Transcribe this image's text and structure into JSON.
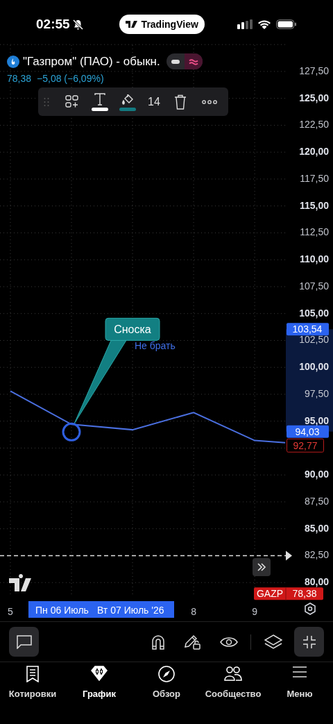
{
  "status_bar": {
    "time": "02:55",
    "app_pill": "TradingView"
  },
  "legend": {
    "symbol": "\"Газпром\" (ПАО) - обыкн.",
    "chart_toggle": [
      {
        "selected": false
      },
      {
        "selected": true
      }
    ],
    "price": "78,38",
    "change": "−5,08 (−6,09%)"
  },
  "drawing_toolbar": {
    "font_size": "14"
  },
  "chart": {
    "chart_data": {
      "type": "line",
      "x": [
        5,
        6,
        7,
        8,
        9,
        9.5
      ],
      "series": [
        {
          "color": "#4a6fe0",
          "values": [
            97.8,
            94.7,
            94.2,
            95.8,
            93.2,
            93.0
          ]
        }
      ],
      "xlim": [
        4.83,
        9.51
      ],
      "ylim": [
        78.66,
        130.27
      ],
      "grid": true,
      "xticks": [
        {
          "value": 5,
          "label": "5"
        },
        {
          "value": 8,
          "label": "8"
        },
        {
          "value": 9,
          "label": "9"
        }
      ],
      "yticks": [
        {
          "value": 127.5,
          "label": "127,50"
        },
        {
          "value": 125,
          "label": "125,00"
        },
        {
          "value": 122.5,
          "label": "122,50"
        },
        {
          "value": 120,
          "label": "120,00"
        },
        {
          "value": 117.5,
          "label": "117,50"
        },
        {
          "value": 115,
          "label": "115,00"
        },
        {
          "value": 112.5,
          "label": "112,50"
        },
        {
          "value": 110,
          "label": "110,00"
        },
        {
          "value": 107.5,
          "label": "107,50"
        },
        {
          "value": 105,
          "label": "105,00"
        },
        {
          "value": 102.5,
          "label": "102,50"
        },
        {
          "value": 100,
          "label": "100,00"
        },
        {
          "value": 97.5,
          "label": "97,50"
        },
        {
          "value": 95,
          "label": "95,00"
        },
        {
          "value": 90,
          "label": "90,00"
        },
        {
          "value": 87.5,
          "label": "87,50"
        },
        {
          "value": 85,
          "label": "85,00"
        },
        {
          "value": 82.5,
          "label": "82,50"
        },
        {
          "value": 80,
          "label": "80,00"
        }
      ],
      "ref_lines": [
        {
          "axis": "y",
          "value": 82.5
        }
      ]
    },
    "drawings": [
      {
        "kind": "callout",
        "text": "Сноска"
      },
      {
        "kind": "text",
        "text": "Не брать"
      }
    ],
    "price_labels": [
      {
        "text": "103,54",
        "kind": "range"
      },
      {
        "text": "94,03",
        "kind": "range"
      },
      {
        "text": "92,77",
        "kind": "outline"
      }
    ],
    "symbol_tag": {
      "name": "GAZP",
      "price": "78,38"
    },
    "time_range": [
      "Пн 06 Июль",
      "Вт 07 Июль '26"
    ]
  },
  "nav": [
    {
      "label": "Котировки",
      "selected": false
    },
    {
      "label": "График",
      "selected": true
    },
    {
      "label": "Обзор",
      "selected": false
    },
    {
      "label": "Сообщество",
      "selected": false
    },
    {
      "label": "Меню",
      "selected": false
    }
  ]
}
